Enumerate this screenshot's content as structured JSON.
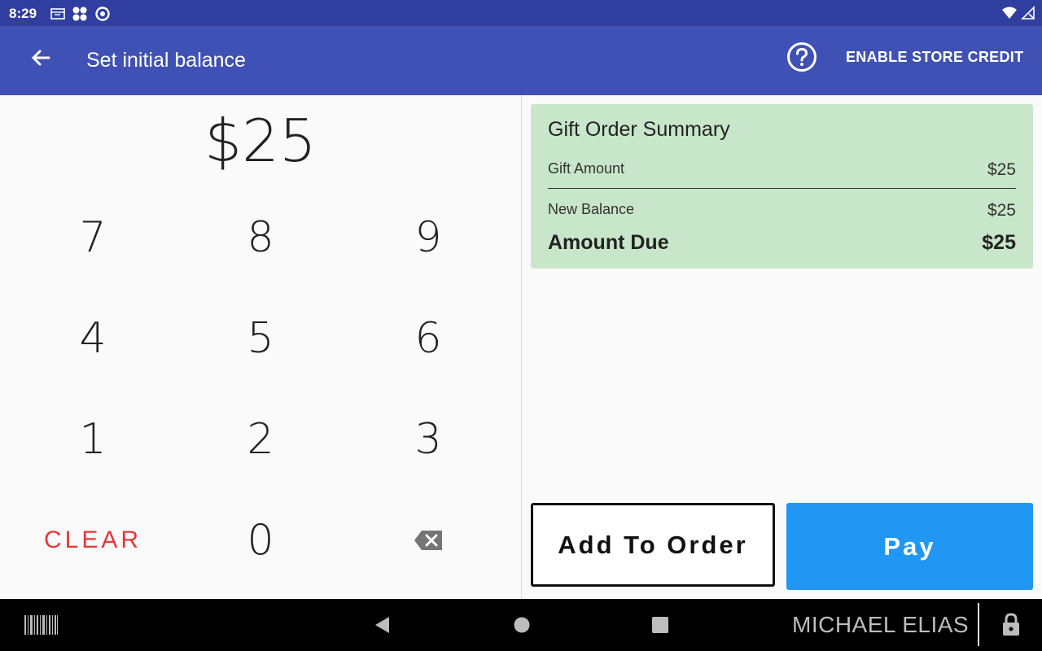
{
  "status_bar": {
    "time": "8:29",
    "icons": [
      "notification-icon",
      "app-grid-icon",
      "sync-icon",
      "wifi-icon",
      "signal-icon"
    ]
  },
  "app_bar": {
    "title": "Set initial balance",
    "action_label": "ENABLE STORE CREDIT",
    "background": "#3f51b5"
  },
  "keypad": {
    "display": "$25",
    "keys": [
      "7",
      "8",
      "9",
      "4",
      "5",
      "6",
      "1",
      "2",
      "3"
    ],
    "clear_label": "CLEAR",
    "zero": "0"
  },
  "summary": {
    "title": "Gift Order Summary",
    "gift_amount_label": "Gift Amount",
    "gift_amount_value": "$25",
    "new_balance_label": "New Balance",
    "new_balance_value": "$25",
    "amount_due_label": "Amount Due",
    "amount_due_value": "$25",
    "background": "#c8e6c9"
  },
  "buttons": {
    "add_to_order": "Add To Order",
    "pay": "Pay",
    "pay_color": "#2196f3"
  },
  "nav_bar": {
    "user_name": "MICHAEL ELIAS"
  }
}
